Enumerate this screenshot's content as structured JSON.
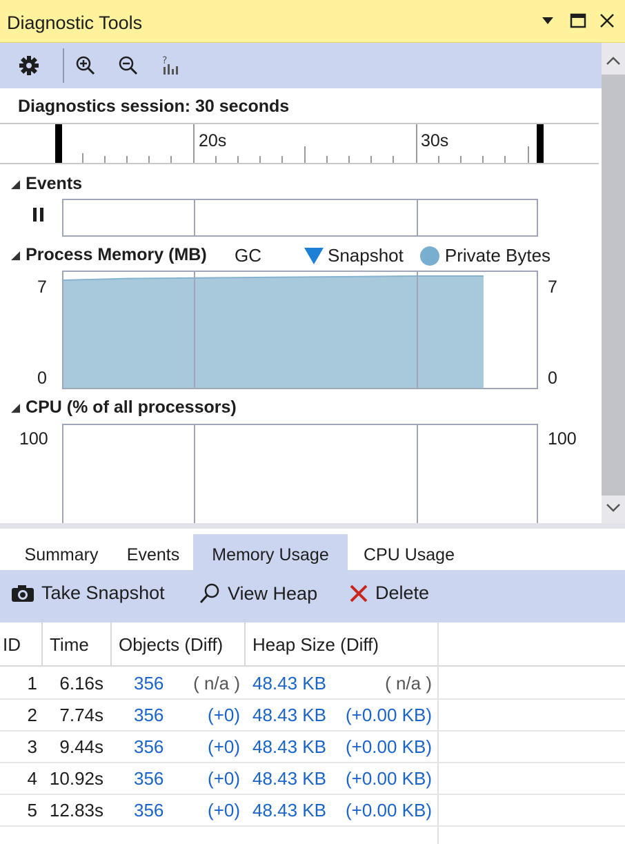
{
  "window": {
    "title": "Diagnostic Tools",
    "controls": [
      "dropdown-icon",
      "maximize-icon",
      "close-icon"
    ]
  },
  "toolbar": {
    "tools": [
      "settings-gear-icon",
      "zoom-in-icon",
      "zoom-out-icon",
      "reset-zoom-icon"
    ]
  },
  "session": {
    "label": "Diagnostics session: 30 seconds",
    "ruler_labels": [
      "20s",
      "30s"
    ]
  },
  "sections": {
    "events": {
      "title": "Events",
      "pause_icon": "pause-icon"
    },
    "memory": {
      "title": "Process Memory (MB)",
      "legend": {
        "gc": "GC",
        "snapshot": "Snapshot",
        "private_bytes": "Private Bytes"
      },
      "axis_top": "7",
      "axis_bottom": "0",
      "fill_color": "#a8c8dc"
    },
    "cpu": {
      "title": "CPU (% of all processors)",
      "axis_top": "100"
    }
  },
  "chart_data": {
    "type": "area",
    "title": "Process Memory (MB)",
    "xlabel": "",
    "ylabel": "",
    "ylim": [
      0,
      7
    ],
    "series": [
      {
        "name": "Private Bytes",
        "x": [
          5,
          9,
          17,
          30,
          33
        ],
        "values": [
          6.5,
          6.5,
          6.6,
          6.75,
          6.75
        ]
      }
    ]
  },
  "tabs": [
    {
      "label": "Summary",
      "active": false
    },
    {
      "label": "Events",
      "active": false
    },
    {
      "label": "Memory Usage",
      "active": true
    },
    {
      "label": "CPU Usage",
      "active": false
    }
  ],
  "actions": {
    "take_snapshot": "Take Snapshot",
    "view_heap": "View Heap",
    "delete": "Delete"
  },
  "table": {
    "headers": [
      "ID",
      "Time",
      "Objects (Diff)",
      "Heap Size (Diff)"
    ],
    "rows": [
      {
        "id": "1",
        "time": "6.16s",
        "objects": "356",
        "objects_diff": "( n/a )",
        "heap": "48.43 KB",
        "heap_diff": "( n/a )"
      },
      {
        "id": "2",
        "time": "7.74s",
        "objects": "356",
        "objects_diff": "(+0)",
        "heap": "48.43 KB",
        "heap_diff": "(+0.00 KB)"
      },
      {
        "id": "3",
        "time": "9.44s",
        "objects": "356",
        "objects_diff": "(+0)",
        "heap": "48.43 KB",
        "heap_diff": "(+0.00 KB)"
      },
      {
        "id": "4",
        "time": "10.92s",
        "objects": "356",
        "objects_diff": "(+0)",
        "heap": "48.43 KB",
        "heap_diff": "(+0.00 KB)"
      },
      {
        "id": "5",
        "time": "12.83s",
        "objects": "356",
        "objects_diff": "(+0)",
        "heap": "48.43 KB",
        "heap_diff": "(+0.00 KB)"
      }
    ]
  }
}
